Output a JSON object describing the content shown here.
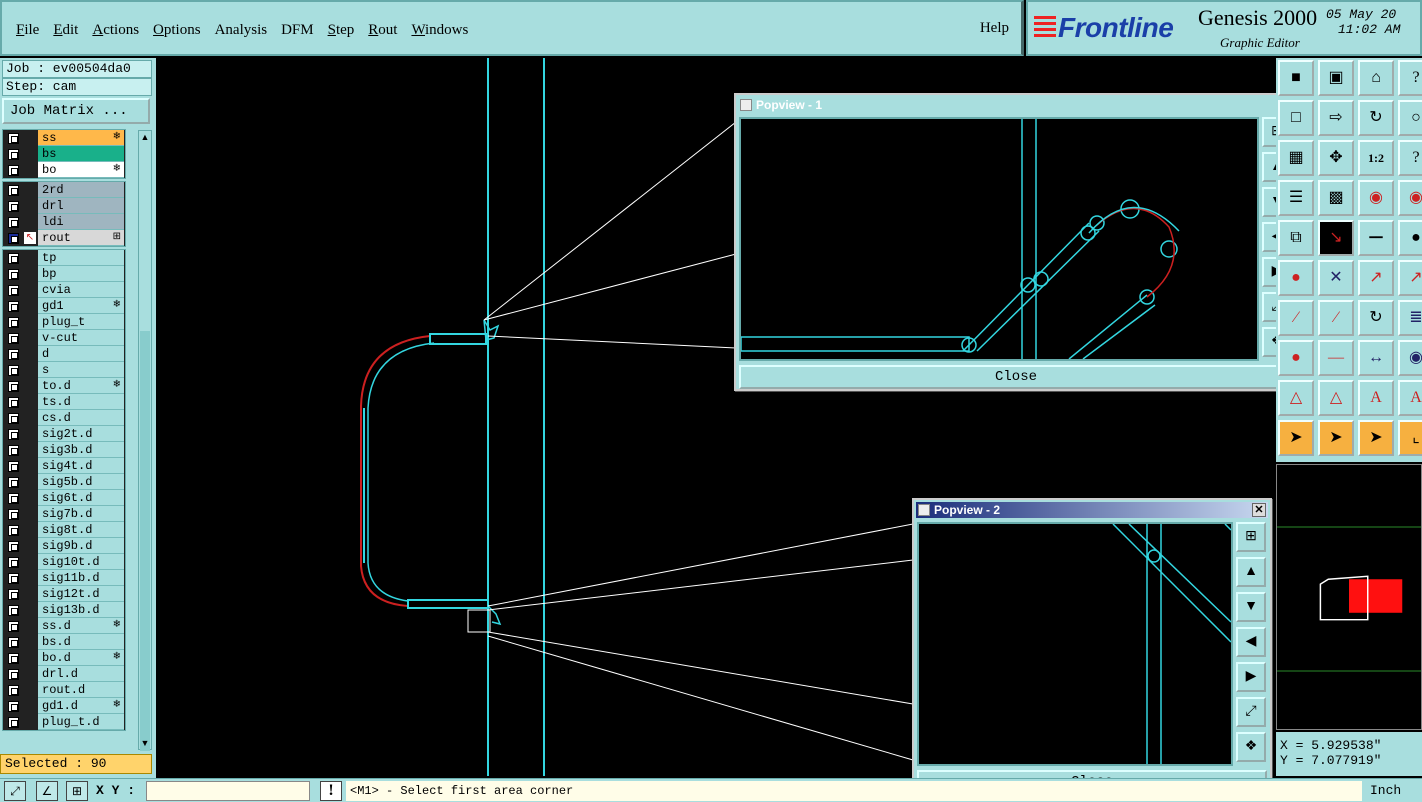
{
  "menubar": {
    "items": [
      {
        "label": "File",
        "u": "F",
        "rest": "ile"
      },
      {
        "label": "Edit",
        "u": "E",
        "rest": "dit"
      },
      {
        "label": "Actions",
        "u": "A",
        "rest": "ctions"
      },
      {
        "label": "Options",
        "u": "O",
        "rest": "ptions"
      },
      {
        "label": "Analysis",
        "u": "",
        "rest": "Analysis"
      },
      {
        "label": "DFM",
        "u": "",
        "rest": "DFM"
      },
      {
        "label": "Step",
        "u": "S",
        "rest": "tep"
      },
      {
        "label": "Rout",
        "u": "R",
        "rest": "out"
      },
      {
        "label": "Windows",
        "u": "W",
        "rest": "indows"
      }
    ],
    "help": "Help"
  },
  "brand": {
    "logo": "Frontline",
    "product": "Genesis 2000",
    "subtitle": "Graphic Editor",
    "date": "05 May 20",
    "time": "11:02 AM"
  },
  "job": {
    "job": "Job : ev00504da0",
    "step": "Step: cam",
    "matrix_button": "Job Matrix ..."
  },
  "layers": [
    {
      "name": "ss",
      "color": "#ffb84a",
      "flag": "❄"
    },
    {
      "name": "bs",
      "color": "#19b08a",
      "flag": ""
    },
    {
      "name": "bo",
      "color": "#ffffff",
      "flag": "❄"
    },
    {
      "name": "2rd",
      "color": "#9fb5c0",
      "flag": ""
    },
    {
      "name": "drl",
      "color": "#9fb5c0",
      "flag": ""
    },
    {
      "name": "ldi",
      "color": "#9fb5c0",
      "flag": ""
    },
    {
      "name": "rout",
      "color": "#d8d8d8",
      "flag": "⊞",
      "active": true
    },
    {
      "name": "tp",
      "color": "#a8dede",
      "flag": ""
    },
    {
      "name": "bp",
      "color": "#a8dede",
      "flag": ""
    },
    {
      "name": "cvia",
      "color": "#a8dede",
      "flag": ""
    },
    {
      "name": "gd1",
      "color": "#a8dede",
      "flag": "❄"
    },
    {
      "name": "plug_t",
      "color": "#a8dede",
      "flag": ""
    },
    {
      "name": "v-cut",
      "color": "#a8dede",
      "flag": ""
    },
    {
      "name": "d",
      "color": "#a8dede",
      "flag": ""
    },
    {
      "name": "s",
      "color": "#a8dede",
      "flag": ""
    },
    {
      "name": "to.d",
      "color": "#a8dede",
      "flag": "❄"
    },
    {
      "name": "ts.d",
      "color": "#a8dede",
      "flag": ""
    },
    {
      "name": "cs.d",
      "color": "#a8dede",
      "flag": ""
    },
    {
      "name": "sig2t.d",
      "color": "#a8dede",
      "flag": ""
    },
    {
      "name": "sig3b.d",
      "color": "#a8dede",
      "flag": ""
    },
    {
      "name": "sig4t.d",
      "color": "#a8dede",
      "flag": ""
    },
    {
      "name": "sig5b.d",
      "color": "#a8dede",
      "flag": ""
    },
    {
      "name": "sig6t.d",
      "color": "#a8dede",
      "flag": ""
    },
    {
      "name": "sig7b.d",
      "color": "#a8dede",
      "flag": ""
    },
    {
      "name": "sig8t.d",
      "color": "#a8dede",
      "flag": ""
    },
    {
      "name": "sig9b.d",
      "color": "#a8dede",
      "flag": ""
    },
    {
      "name": "sig10t.d",
      "color": "#a8dede",
      "flag": ""
    },
    {
      "name": "sig11b.d",
      "color": "#a8dede",
      "flag": ""
    },
    {
      "name": "sig12t.d",
      "color": "#a8dede",
      "flag": ""
    },
    {
      "name": "sig13b.d",
      "color": "#a8dede",
      "flag": ""
    },
    {
      "name": "ss.d",
      "color": "#a8dede",
      "flag": "❄"
    },
    {
      "name": "bs.d",
      "color": "#a8dede",
      "flag": ""
    },
    {
      "name": "bo.d",
      "color": "#a8dede",
      "flag": "❄"
    },
    {
      "name": "drl.d",
      "color": "#a8dede",
      "flag": ""
    },
    {
      "name": "rout.d",
      "color": "#a8dede",
      "flag": ""
    },
    {
      "name": "gd1.d",
      "color": "#a8dede",
      "flag": "❄"
    },
    {
      "name": "plug_t.d",
      "color": "#a8dede",
      "flag": ""
    }
  ],
  "selected": "Selected : 90",
  "popview1": {
    "title": "Popview - 1",
    "close": "Close"
  },
  "popview2": {
    "title": "Popview - 2",
    "close": "Close"
  },
  "coords": {
    "x": "X = 5.929538\"",
    "y": "Y = 7.077919\""
  },
  "bottom": {
    "xy_label": "X Y :",
    "xy_value": "",
    "prompt": "<M1> - Select first area corner",
    "units": "Inch"
  },
  "colors": {
    "panel": "#a8dede",
    "trace": "#33d6e0",
    "rout": "#cc2020",
    "line": "#ffffff"
  }
}
